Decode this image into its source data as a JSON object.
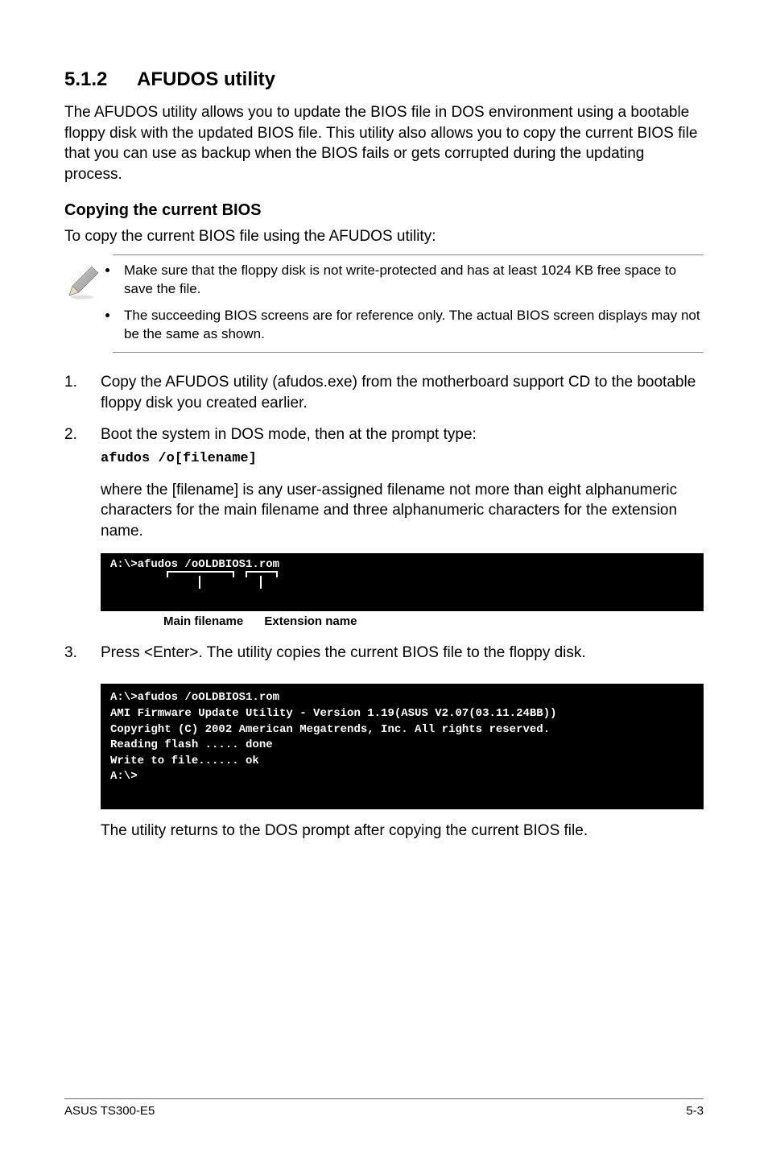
{
  "heading": {
    "number": "5.1.2",
    "title": "AFUDOS utility"
  },
  "intro": "The AFUDOS utility allows you to update the BIOS file in DOS environment using a bootable floppy disk with the updated BIOS file. This utility also allows you to copy the current BIOS file that you can use as backup when the BIOS fails or gets corrupted during the updating process.",
  "sub_heading": "Copying the current BIOS",
  "sub_intro": "To copy the current BIOS file using the AFUDOS utility:",
  "notes": [
    "Make sure that the floppy disk is not write-protected and has at least 1024 KB free space to save the file.",
    "The succeeding BIOS screens are for reference only. The actual BIOS screen displays may not be the same as shown."
  ],
  "steps": {
    "s1": {
      "idx": "1.",
      "text": "Copy the AFUDOS utility (afudos.exe) from the motherboard support CD to the bootable floppy disk you created earlier."
    },
    "s2": {
      "idx": "2.",
      "text": "Boot the system in DOS mode, then at the prompt type:",
      "cmd": "afudos /o[filename]",
      "explain": "where the [filename] is any user-assigned filename not more than eight alphanumeric characters  for the main filename and three alphanumeric characters for the extension name."
    },
    "s3": {
      "idx": "3.",
      "text": "Press <Enter>. The utility copies the current BIOS file to the floppy disk."
    }
  },
  "terminal1": {
    "line1": "A:\\>afudos /oOLDBIOS1.rom"
  },
  "annotations": {
    "main_filename": "Main filename",
    "extension_name": "Extension name"
  },
  "terminal2": {
    "l1": "A:\\>afudos /oOLDBIOS1.rom",
    "l2": "AMI Firmware Update Utility - Version 1.19(ASUS V2.07(03.11.24BB))",
    "l3": "Copyright (C) 2002 American Megatrends, Inc. All rights reserved.",
    "l4": "   Reading flash ..... done",
    "l5": "   Write to file...... ok",
    "l6": "A:\\>"
  },
  "closing": "The utility returns to the DOS prompt after copying the current BIOS file.",
  "footer": {
    "left": "ASUS TS300-E5",
    "right": "5-3"
  }
}
